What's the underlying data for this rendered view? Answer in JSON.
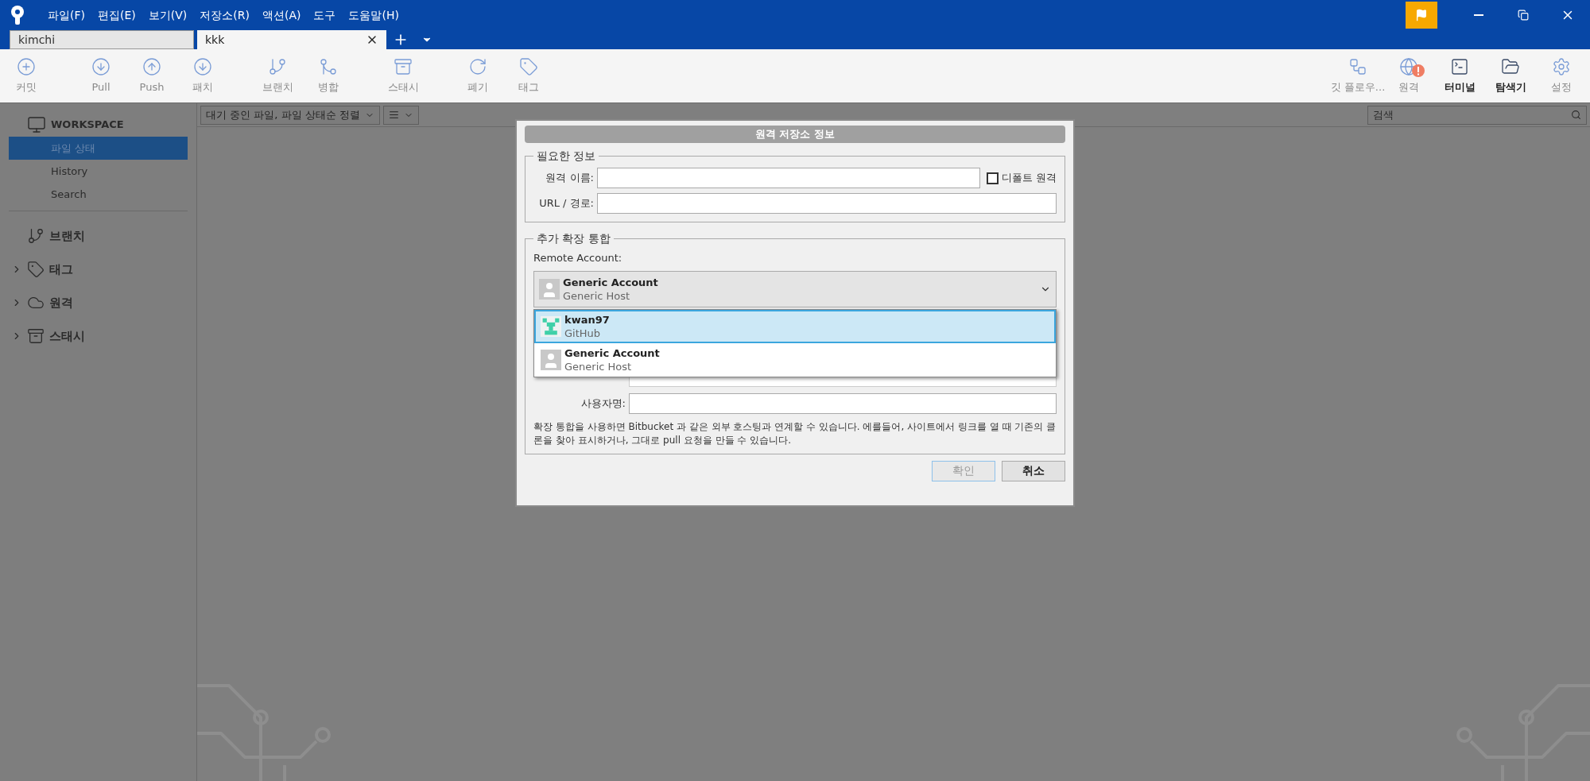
{
  "menu": [
    "파일(F)",
    "편집(E)",
    "보기(V)",
    "저장소(R)",
    "액션(A)",
    "도구",
    "도움말(H)"
  ],
  "tabs": [
    {
      "label": "kimchi",
      "selected": false
    },
    {
      "label": "kkk",
      "selected": true
    }
  ],
  "toolbar_left": [
    {
      "kind": "commit",
      "label": "커밋",
      "disabled": true
    },
    {
      "kind": "pull",
      "label": "Pull",
      "disabled": true
    },
    {
      "kind": "push",
      "label": "Push",
      "disabled": true
    },
    {
      "kind": "fetch",
      "label": "패치",
      "disabled": true
    },
    {
      "kind": "branch",
      "label": "브랜치",
      "disabled": true
    },
    {
      "kind": "merge",
      "label": "병합",
      "disabled": true
    },
    {
      "kind": "stash",
      "label": "스태시",
      "disabled": true
    },
    {
      "kind": "discard",
      "label": "폐기",
      "disabled": true
    },
    {
      "kind": "tag",
      "label": "태그",
      "disabled": true
    }
  ],
  "toolbar_right": [
    {
      "kind": "gitflow",
      "label": "깃 플로우...",
      "disabled": true,
      "alert": false
    },
    {
      "kind": "remote",
      "label": "원격",
      "disabled": true,
      "alert": true
    },
    {
      "kind": "terminal",
      "label": "터미널",
      "disabled": false,
      "alert": false
    },
    {
      "kind": "explorer",
      "label": "탐색기",
      "disabled": false,
      "alert": false
    },
    {
      "kind": "settings",
      "label": "설정",
      "disabled": true,
      "alert": false
    }
  ],
  "sidebar": {
    "workspace": "WORKSPACE",
    "items": [
      {
        "label": "파일 상태",
        "selected": true
      },
      {
        "label": "History",
        "selected": false
      },
      {
        "label": "Search",
        "selected": false
      }
    ],
    "sections": [
      {
        "kind": "branch",
        "label": "브랜치",
        "expandable": false
      },
      {
        "kind": "tag",
        "label": "태그",
        "expandable": true
      },
      {
        "kind": "remote",
        "label": "원격",
        "expandable": true
      },
      {
        "kind": "stash",
        "label": "스태시",
        "expandable": true
      }
    ]
  },
  "filter": {
    "value": "대기 중인 파일, 파일 상태순 정렬"
  },
  "search": {
    "placeholder": "검색"
  },
  "dialog": {
    "title": "원격 저장소 정보",
    "required": {
      "legend": "필요한 정보",
      "name_label": "원격 이름:",
      "default_label": "디폴트 원격",
      "default_checked": false,
      "url_label": "URL / 경로:"
    },
    "integration": {
      "legend": "추가 확장 통합",
      "account_label": "Remote Account:",
      "account": {
        "name": "Generic Account",
        "host": "Generic Host"
      },
      "options": [
        {
          "kind": "github",
          "name": "kwan97",
          "host": "GitHub",
          "selected": true
        },
        {
          "kind": "generic",
          "name": "Generic Account",
          "host": "Generic Host",
          "selected": false
        }
      ],
      "username_label": "사용자명:",
      "description": "확장 통합을 사용하면 Bitbucket 과 같은 외부 호스팅과 연계할 수 있습니다. 에를들어, 사이트에서 링크를 열 때 기존의 클론을 찾아 표시하거나, 그대로 pull 요청을 만들 수 있습니다."
    },
    "buttons": [
      {
        "label": "확인",
        "disabled": true
      },
      {
        "label": "취소",
        "disabled": false
      }
    ]
  }
}
